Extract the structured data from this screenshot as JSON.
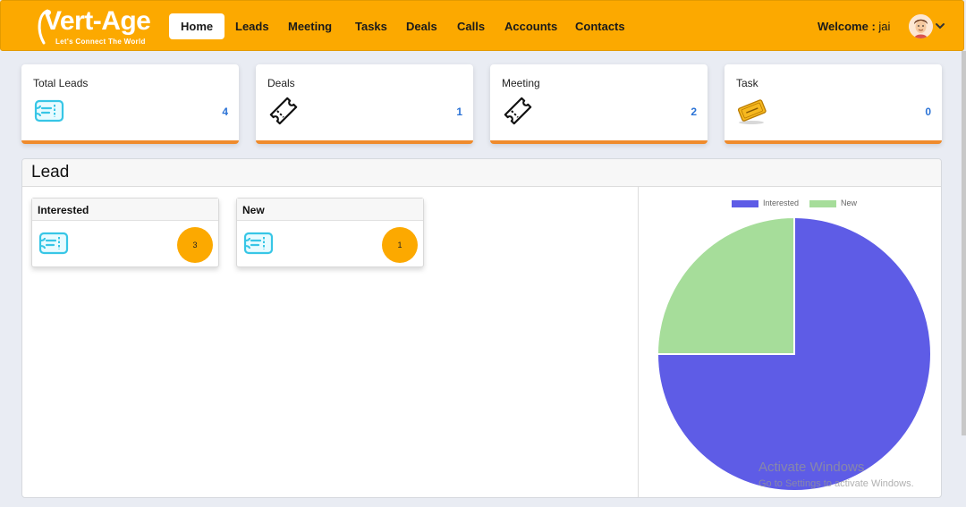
{
  "brand": {
    "name": "Vert-Age",
    "tagline": "Let's Connect The World"
  },
  "nav": {
    "items": [
      {
        "label": "Home",
        "active": true
      },
      {
        "label": "Leads",
        "active": false
      },
      {
        "label": "Meeting",
        "active": false
      },
      {
        "label": "Tasks",
        "active": false
      },
      {
        "label": "Deals",
        "active": false
      },
      {
        "label": "Calls",
        "active": false
      },
      {
        "label": "Accounts",
        "active": false
      },
      {
        "label": "Contacts",
        "active": false
      }
    ],
    "welcome_prefix": "Welcome :",
    "user_name": "jai",
    "avatar_icon": "user-avatar-icon",
    "menu_icon": "chevron-down-icon"
  },
  "stats": [
    {
      "title": "Total Leads",
      "value": "4",
      "icon": "ticket-icon"
    },
    {
      "title": "Deals",
      "value": "1",
      "icon": "ticket-outline-icon"
    },
    {
      "title": "Meeting",
      "value": "2",
      "icon": "ticket-outline-icon"
    },
    {
      "title": "Task",
      "value": "0",
      "icon": "golden-ticket-icon"
    }
  ],
  "lead": {
    "title": "Lead",
    "cards": [
      {
        "title": "Interested",
        "count": "3",
        "icon": "ticket-icon"
      },
      {
        "title": "New",
        "count": "1",
        "icon": "ticket-icon"
      }
    ]
  },
  "chart_data": {
    "type": "pie",
    "title": "",
    "categories": [
      "Interested",
      "New"
    ],
    "values": [
      3,
      1
    ],
    "colors": [
      "#5e5ce6",
      "#a6dd9a"
    ],
    "legend": "top"
  },
  "watermark": {
    "line1": "Activate Windows",
    "line2": "Go to Settings to activate Windows."
  },
  "colors": {
    "navbar": "#fca900",
    "accent_border": "#ef8b2c",
    "value_text": "#2b73d6"
  }
}
